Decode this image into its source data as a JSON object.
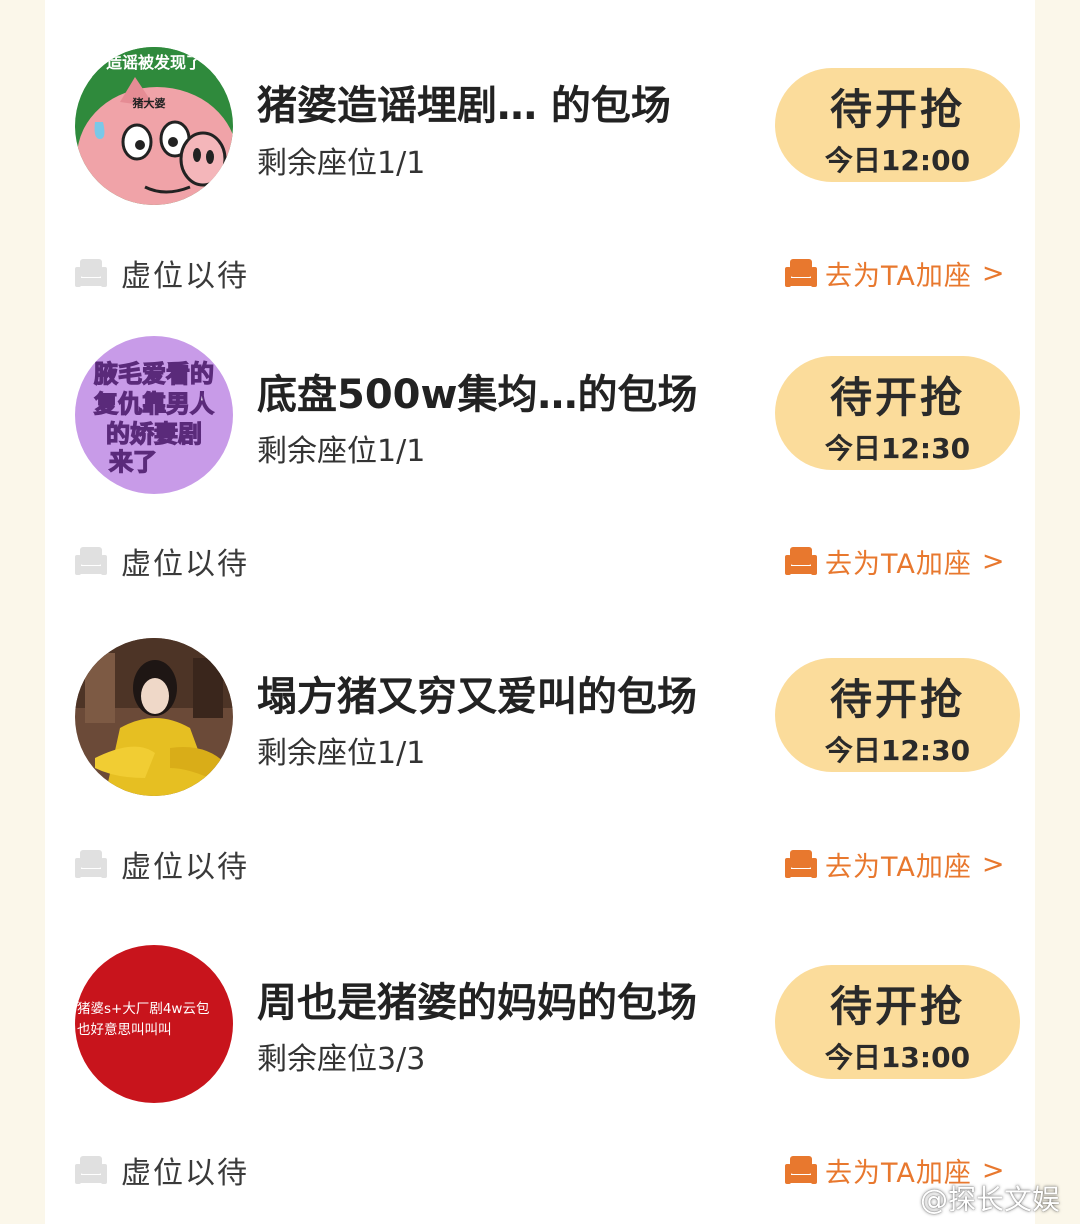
{
  "colors": {
    "page_bg": "#fbf7ea",
    "card_bg": "#ffffff",
    "button_bg": "#fbdc9b",
    "accent_orange": "#e8782e",
    "seat_icon_gray": "#e0e0e0"
  },
  "rooms": [
    {
      "title": "猪婆造谣埋剧…    的包场",
      "seats": "剩余座位1/1",
      "status": "待开抢",
      "time": "今日12:00",
      "avatar_lines": [
        "造谣被发现了",
        "猪大婆"
      ],
      "wait_label": "虚位以待",
      "add_label": "去为TA加座",
      "add_arrow": ">"
    },
    {
      "title": "底盘500w集均…的包场",
      "seats": "剩余座位1/1",
      "status": "待开抢",
      "time": "今日12:30",
      "avatar_lines": [
        "腋毛爱看的",
        "复仇靠男人",
        "的娇妻剧",
        "来了"
      ],
      "wait_label": "虚位以待",
      "add_label": "去为TA加座",
      "add_arrow": ">"
    },
    {
      "title": "塌方猪又穷又爱叫的包场",
      "seats": "剩余座位1/1",
      "status": "待开抢",
      "time": "今日12:30",
      "avatar_lines": [],
      "wait_label": "虚位以待",
      "add_label": "去为TA加座",
      "add_arrow": ">"
    },
    {
      "title": "周也是猪婆的妈妈的包场",
      "seats": "剩余座位3/3",
      "status": "待开抢",
      "time": "今日13:00",
      "avatar_lines": [
        "猪婆s+大厂剧4w云包",
        "也好意思叫叫叫"
      ],
      "wait_label": "虚位以待",
      "add_label": "去为TA加座",
      "add_arrow": ">"
    }
  ],
  "watermark": "@探长文娱"
}
